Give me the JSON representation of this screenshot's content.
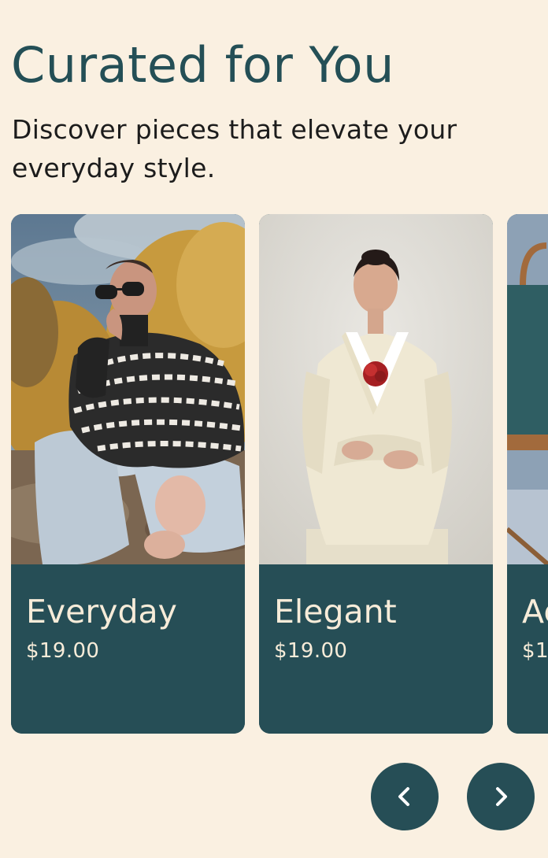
{
  "header": {
    "title": "Curated for You",
    "subtitle": "Discover pieces that elevate your everyday style."
  },
  "carousel": {
    "cards": [
      {
        "title": "Everyday",
        "price": "$19.00"
      },
      {
        "title": "Elegant",
        "price": "$19.00"
      },
      {
        "title": "Ac",
        "price": "$1"
      }
    ],
    "prev_icon": "chevron-left-icon",
    "next_icon": "chevron-right-icon"
  },
  "colors": {
    "background": "#faf0e1",
    "accent": "#264e56",
    "card_text": "#f7ecd9"
  }
}
